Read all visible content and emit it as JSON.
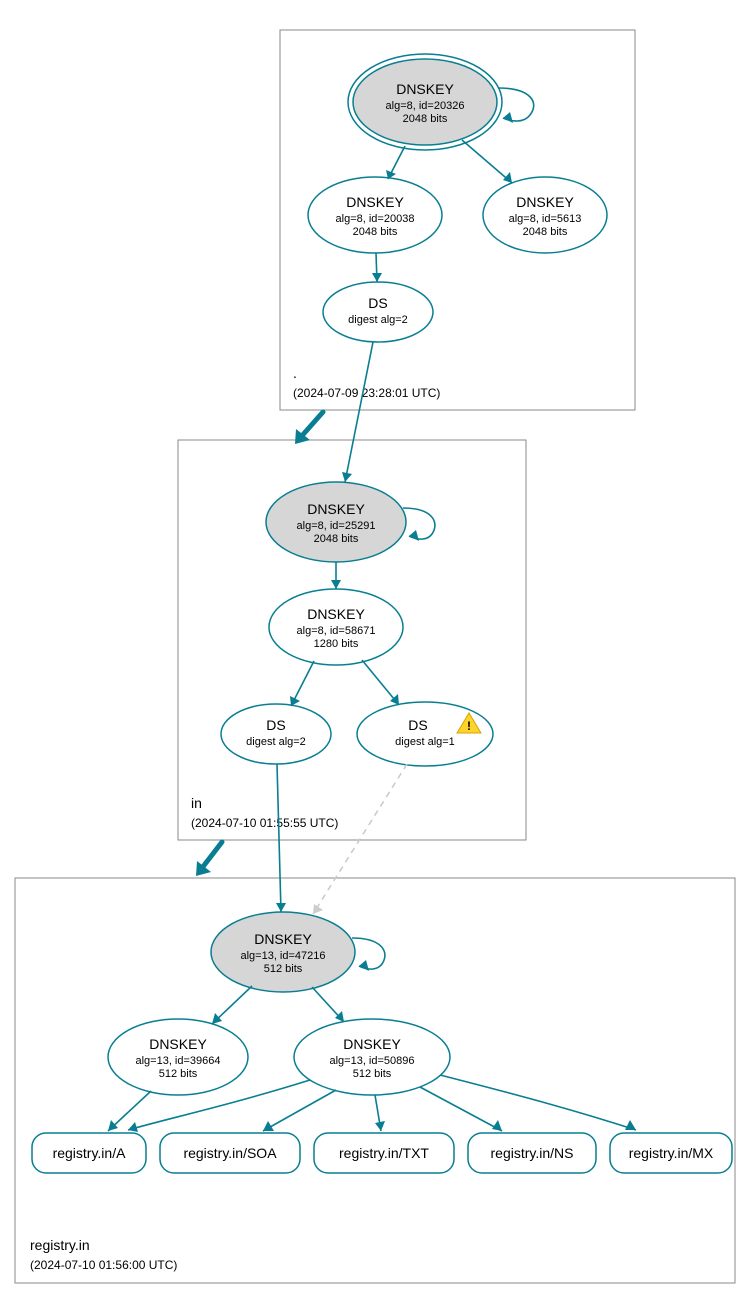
{
  "colors": {
    "accent": "#097e92",
    "ksk_fill": "#d6d6d6"
  },
  "zones": {
    "root": {
      "label": ".",
      "timestamp": "(2024-07-09 23:28:01 UTC)",
      "nodes": {
        "ksk": {
          "title": "DNSKEY",
          "l1": "alg=8, id=20326",
          "l2": "2048 bits"
        },
        "zsk1": {
          "title": "DNSKEY",
          "l1": "alg=8, id=20038",
          "l2": "2048 bits"
        },
        "zsk2": {
          "title": "DNSKEY",
          "l1": "alg=8, id=5613",
          "l2": "2048 bits"
        },
        "ds": {
          "title": "DS",
          "l1": "digest alg=2"
        }
      }
    },
    "in": {
      "label": "in",
      "timestamp": "(2024-07-10 01:55:55 UTC)",
      "nodes": {
        "ksk": {
          "title": "DNSKEY",
          "l1": "alg=8, id=25291",
          "l2": "2048 bits"
        },
        "zsk": {
          "title": "DNSKEY",
          "l1": "alg=8, id=58671",
          "l2": "1280 bits"
        },
        "ds2": {
          "title": "DS",
          "l1": "digest alg=2"
        },
        "ds1": {
          "title": "DS",
          "l1": "digest alg=1"
        }
      }
    },
    "registry": {
      "label": "registry.in",
      "timestamp": "(2024-07-10 01:56:00 UTC)",
      "nodes": {
        "ksk": {
          "title": "DNSKEY",
          "l1": "alg=13, id=47216",
          "l2": "512 bits"
        },
        "zskA": {
          "title": "DNSKEY",
          "l1": "alg=13, id=39664",
          "l2": "512 bits"
        },
        "zskB": {
          "title": "DNSKEY",
          "l1": "alg=13, id=50896",
          "l2": "512 bits"
        }
      },
      "records": {
        "a": "registry.in/A",
        "soa": "registry.in/SOA",
        "txt": "registry.in/TXT",
        "ns": "registry.in/NS",
        "mx": "registry.in/MX"
      }
    }
  }
}
